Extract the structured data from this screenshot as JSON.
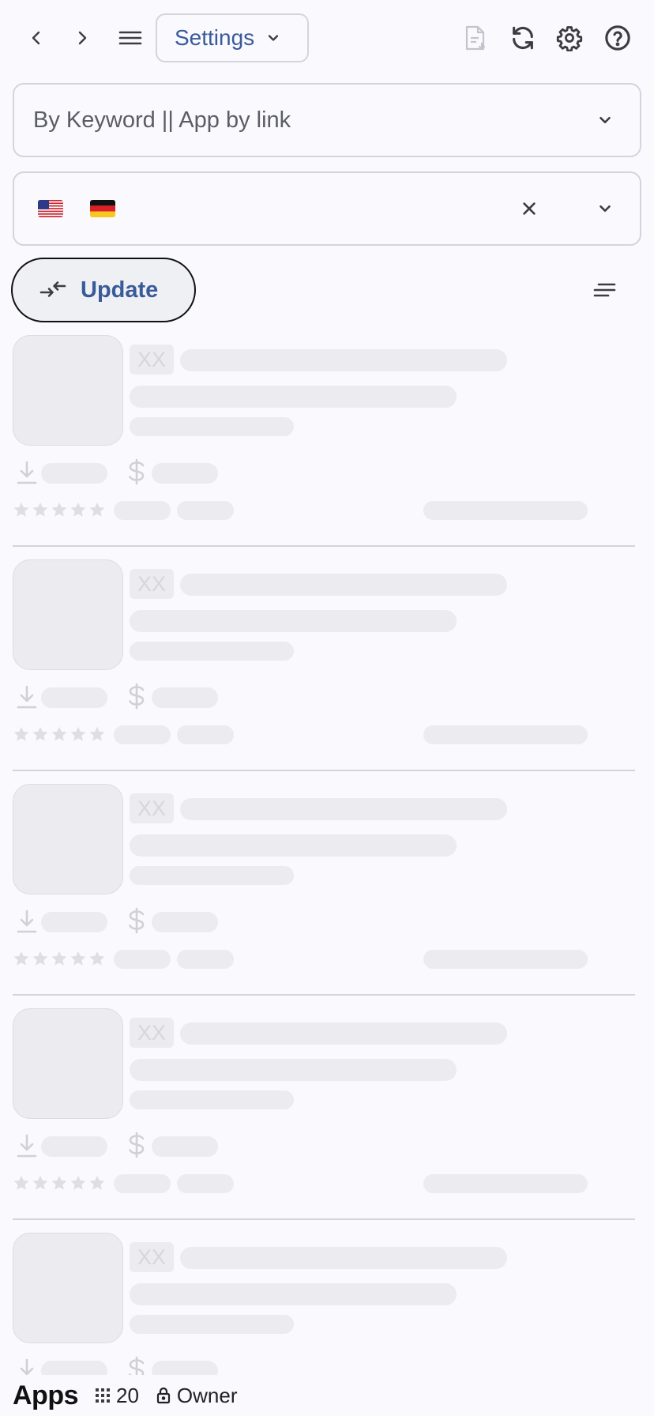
{
  "toolbar": {
    "settings_label": "Settings",
    "icons": [
      "chevron-left-icon",
      "chevron-right-icon",
      "menu-icon",
      "chevron-down-icon",
      "file-download-icon",
      "refresh-icon",
      "gear-icon",
      "help-icon"
    ]
  },
  "keyword_field": {
    "placeholder": "By Keyword || App by link"
  },
  "country_field": {
    "selected_flags": [
      "US",
      "DE"
    ]
  },
  "update_button": {
    "label": "Update"
  },
  "skeleton": {
    "placeholder_badge": "XX",
    "card_count": 5
  },
  "bottom_bar": {
    "title": "Apps",
    "count": "20",
    "role": "Owner"
  },
  "colors": {
    "accent": "#3a5a9a",
    "background": "#f9f9fe",
    "skeleton": "#ebebf0",
    "border": "#d4d4dc"
  }
}
